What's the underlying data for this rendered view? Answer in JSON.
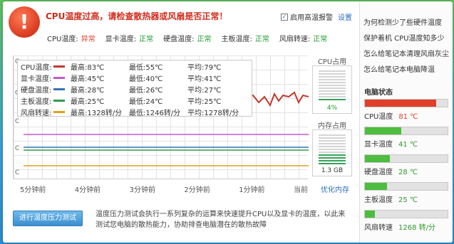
{
  "header": {
    "alert_symbol": "!",
    "warning_title": "CPU温度过高，请检查散热器或风扇是否正常！",
    "alarm_checkbox_mark": "✓",
    "alarm_toggle_label": "启用高温报警",
    "settings_link": "设置"
  },
  "status_row": [
    {
      "label": "CPU温度:",
      "status": "异常",
      "state": "bad"
    },
    {
      "label": "显卡温度:",
      "status": "正常",
      "state": "ok"
    },
    {
      "label": "硬盘温度:",
      "status": "正常",
      "state": "ok"
    },
    {
      "label": "主板温度:",
      "status": "正常",
      "state": "ok"
    },
    {
      "label": "风扇转速:",
      "status": "正常",
      "state": "ok"
    }
  ],
  "graph": {
    "c_markers": [
      "C",
      "C",
      "C",
      "C",
      "C"
    ],
    "legend": [
      {
        "name": "CPU温度:",
        "max": "最高:83℃",
        "min": "最低:55℃",
        "avg": "平均:79℃",
        "color": "#c0392b"
      },
      {
        "name": "显卡温度:",
        "max": "最高:45℃",
        "min": "最低:40℃",
        "avg": "平均:41℃",
        "color": "#c35bd0"
      },
      {
        "name": "硬盘温度:",
        "max": "最高:28℃",
        "min": "最低:26℃",
        "avg": "平均:27℃",
        "color": "#3a6fb5"
      },
      {
        "name": "主板温度:",
        "max": "最高:25℃",
        "min": "最低:24℃",
        "avg": "平均:25℃",
        "color": "#2e9c4a"
      },
      {
        "name": "风扇转速:",
        "max": "最高:1328转/分",
        "min": "最低:1246转/分",
        "avg": "平均:1278转/分",
        "color": "#e0a21b"
      }
    ],
    "time_labels": [
      "5分钟前",
      "4分钟前",
      "3分钟前",
      "2分钟前",
      "1分钟前",
      "当前"
    ]
  },
  "cpu_usage": {
    "title": "CPU占用",
    "value": "4%",
    "fraction": 0.04
  },
  "memory_usage": {
    "title": "内存占用",
    "value": "1.3 GB",
    "fraction": 0.35
  },
  "optimize_link": "优化内存",
  "stress_test": {
    "button_label": "进行温度压力测试",
    "description": "温度压力测试会执行一系列复杂的运算来快速提升CPU以及显卡的温度，以此来测试您电脑的散热能力，协助排查电脑潜在的散热故障"
  },
  "sidebar": {
    "faq_links": [
      "为何检测少了些硬件温度",
      "保护着机 CPU温度知多少",
      "怎么给笔记本清理风扇灰尘",
      "怎么给笔记本电脑降温"
    ],
    "sensors_title": "电脑状态",
    "sensors": [
      {
        "label": "CPU温度",
        "value": "81 ℃",
        "fraction": 0.86,
        "color": "#e0402a",
        "value_color": "#e0402a"
      },
      {
        "label": "显卡温度",
        "value": "41 ℃",
        "fraction": 0.44,
        "color": "#4dbd3f",
        "value_color": "#2f9a2a"
      },
      {
        "label": "硬盘温度",
        "value": "28 ℃",
        "fraction": 0.3,
        "color": "#4dbd3f",
        "value_color": "#2f9a2a"
      },
      {
        "label": "主板温度",
        "value": "25 ℃",
        "fraction": 0.27,
        "color": "#4dbd3f",
        "value_color": "#2f9a2a"
      },
      {
        "label": "风扇转速",
        "value": "1268 转/分",
        "fraction": 0.12,
        "color": "#4dbd3f",
        "value_color": "#2f9a2a"
      }
    ]
  }
}
